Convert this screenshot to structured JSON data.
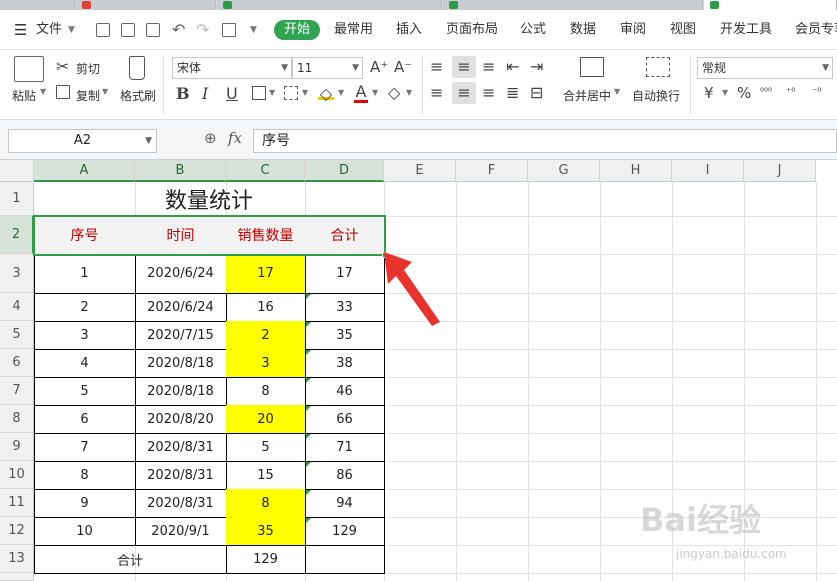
{
  "menubar": {
    "file_label": "文件",
    "tabs": [
      {
        "label": "开始"
      },
      {
        "label": "最常用"
      },
      {
        "label": "插入"
      },
      {
        "label": "页面布局"
      },
      {
        "label": "公式"
      },
      {
        "label": "数据"
      },
      {
        "label": "审阅"
      },
      {
        "label": "视图"
      },
      {
        "label": "开发工具"
      },
      {
        "label": "会员专享"
      }
    ]
  },
  "ribbon": {
    "paste": "粘贴",
    "cut": "剪切",
    "copy": "复制",
    "format_painter": "格式刷",
    "font_name": "宋体",
    "font_size": "11",
    "merge_center": "合并居中",
    "wrap_text": "自动换行",
    "number_format": "常规",
    "currency_symbol": "¥",
    "percent_symbol": "%"
  },
  "formula_bar": {
    "name_box": "A2",
    "fx": "fx",
    "content": "序号"
  },
  "sheet": {
    "columns": [
      "A",
      "B",
      "C",
      "D",
      "E",
      "F",
      "G",
      "H",
      "I",
      "J"
    ],
    "rows": [
      "1",
      "2",
      "3",
      "4",
      "5",
      "6",
      "7",
      "8",
      "9",
      "10",
      "11",
      "12",
      "13"
    ],
    "title": "数量统计",
    "headers": [
      "序号",
      "时间",
      "销售数量",
      "合计"
    ],
    "data": [
      [
        "1",
        "2020/6/24",
        "17",
        "17"
      ],
      [
        "2",
        "2020/6/24",
        "16",
        "33"
      ],
      [
        "3",
        "2020/7/15",
        "2",
        "35"
      ],
      [
        "4",
        "2020/8/18",
        "3",
        "38"
      ],
      [
        "5",
        "2020/8/18",
        "8",
        "46"
      ],
      [
        "6",
        "2020/8/20",
        "20",
        "66"
      ],
      [
        "7",
        "2020/8/31",
        "5",
        "71"
      ],
      [
        "8",
        "2020/8/31",
        "15",
        "86"
      ],
      [
        "9",
        "2020/8/31",
        "8",
        "94"
      ],
      [
        "10",
        "2020/9/1",
        "35",
        "129"
      ]
    ],
    "highlighted_rows": [
      0,
      2,
      3,
      5,
      8,
      9
    ],
    "total_label": "合计",
    "total_value": "129"
  },
  "watermark": {
    "brand": "Bai经验",
    "url": "jingyan.baidu.com"
  },
  "colors": {
    "accent": "#2e9b48",
    "highlight": "#ffff00",
    "header_text": "#c00000",
    "arrow": "#e8322c"
  }
}
